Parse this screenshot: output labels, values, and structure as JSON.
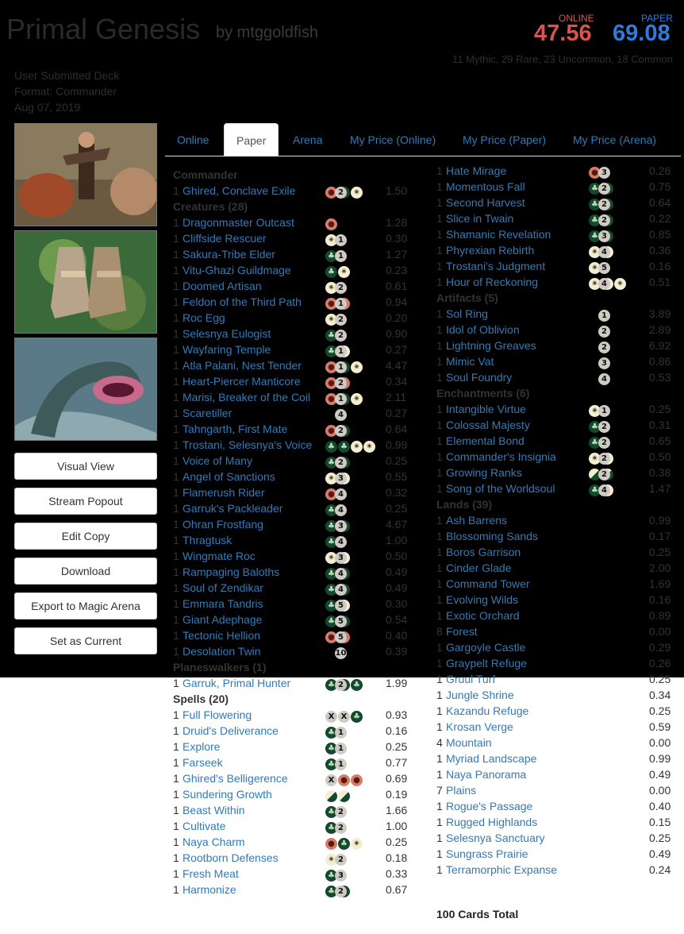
{
  "header": {
    "title": "Primal Genesis",
    "author": "by mtggoldfish",
    "online_label": "ONLINE",
    "online_price": "47.56",
    "paper_label": "PAPER",
    "paper_price": "69.08",
    "rarity_summary": "11 Mythic, 29 Rare, 23 Uncommon, 18 Common"
  },
  "meta": {
    "submitted": "User Submitted Deck",
    "format": "Format: Commander",
    "date": "Aug 07, 2019"
  },
  "colors": {
    "online": "#d9534f",
    "paper": "#2f7bdc",
    "link": "#337ab7"
  },
  "sidebar": {
    "images": [
      "ghired-art",
      "boots-art",
      "serpent-art"
    ],
    "buttons": [
      "Visual View",
      "Stream Popout",
      "Edit Copy",
      "Download",
      "Export to Magic Arena",
      "Set as Current"
    ]
  },
  "tabs": [
    "Online",
    "Paper",
    "Arena",
    "My Price (Online)",
    "My Price (Paper)",
    "My Price (Arena)"
  ],
  "active_tab": "Paper",
  "left_column": [
    {
      "type": "head",
      "text": "Commander"
    },
    {
      "type": "card",
      "qty": "1",
      "name": "Ghired, Conclave Exile",
      "mana": [
        "2",
        "R",
        "G",
        "W"
      ],
      "price": "1.50"
    },
    {
      "type": "head",
      "text": "Creatures (28)"
    },
    {
      "type": "card",
      "qty": "1",
      "name": "Dragonmaster Outcast",
      "mana": [
        "R"
      ],
      "price": "1.28"
    },
    {
      "type": "card",
      "qty": "1",
      "name": "Cliffside Rescuer",
      "mana": [
        "1",
        "W"
      ],
      "price": "0.30"
    },
    {
      "type": "card",
      "qty": "1",
      "name": "Sakura-Tribe Elder",
      "mana": [
        "1",
        "G"
      ],
      "price": "1.27"
    },
    {
      "type": "card",
      "qty": "1",
      "name": "Vitu-Ghazi Guildmage",
      "mana": [
        "G",
        "W"
      ],
      "price": "0.23"
    },
    {
      "type": "card",
      "qty": "1",
      "name": "Doomed Artisan",
      "mana": [
        "2",
        "W"
      ],
      "price": "0.61"
    },
    {
      "type": "card",
      "qty": "1",
      "name": "Feldon of the Third Path",
      "mana": [
        "1",
        "R",
        "R"
      ],
      "price": "0.94"
    },
    {
      "type": "card",
      "qty": "1",
      "name": "Roc Egg",
      "mana": [
        "2",
        "W"
      ],
      "price": "0.20"
    },
    {
      "type": "card",
      "qty": "1",
      "name": "Selesnya Eulogist",
      "mana": [
        "2",
        "G"
      ],
      "price": "0.90"
    },
    {
      "type": "card",
      "qty": "1",
      "name": "Wayfaring Temple",
      "mana": [
        "1",
        "G",
        "W"
      ],
      "price": "0.27"
    },
    {
      "type": "card",
      "qty": "1",
      "name": "Atla Palani, Nest Tender",
      "mana": [
        "1",
        "R",
        "G",
        "W"
      ],
      "price": "4.47"
    },
    {
      "type": "card",
      "qty": "1",
      "name": "Heart-Piercer Manticore",
      "mana": [
        "2",
        "R",
        "R"
      ],
      "price": "0.34"
    },
    {
      "type": "card",
      "qty": "1",
      "name": "Marisi, Breaker of the Coil",
      "mana": [
        "1",
        "R",
        "G",
        "W"
      ],
      "price": "2.11"
    },
    {
      "type": "card",
      "qty": "1",
      "name": "Scaretiller",
      "mana": [
        "4"
      ],
      "price": "0.27"
    },
    {
      "type": "card",
      "qty": "1",
      "name": "Tahngarth, First Mate",
      "mana": [
        "2",
        "R",
        "G"
      ],
      "price": "0.64"
    },
    {
      "type": "card",
      "qty": "1",
      "name": "Trostani, Selesnya's Voice",
      "mana": [
        "G",
        "G",
        "W",
        "W"
      ],
      "price": "0.99"
    },
    {
      "type": "card",
      "qty": "1",
      "name": "Voice of Many",
      "mana": [
        "2",
        "G",
        "G"
      ],
      "price": "0.25"
    },
    {
      "type": "card",
      "qty": "1",
      "name": "Angel of Sanctions",
      "mana": [
        "3",
        "W",
        "W"
      ],
      "price": "0.55"
    },
    {
      "type": "card",
      "qty": "1",
      "name": "Flamerush Rider",
      "mana": [
        "4",
        "R"
      ],
      "price": "0.32"
    },
    {
      "type": "card",
      "qty": "1",
      "name": "Garruk's Packleader",
      "mana": [
        "4",
        "G"
      ],
      "price": "0.25"
    },
    {
      "type": "card",
      "qty": "1",
      "name": "Ohran Frostfang",
      "mana": [
        "3",
        "G",
        "G"
      ],
      "price": "4.67"
    },
    {
      "type": "card",
      "qty": "1",
      "name": "Thragtusk",
      "mana": [
        "4",
        "G"
      ],
      "price": "1.00"
    },
    {
      "type": "card",
      "qty": "1",
      "name": "Wingmate Roc",
      "mana": [
        "3",
        "W",
        "W"
      ],
      "price": "0.50"
    },
    {
      "type": "card",
      "qty": "1",
      "name": "Rampaging Baloths",
      "mana": [
        "4",
        "G",
        "G"
      ],
      "price": "0.49"
    },
    {
      "type": "card",
      "qty": "1",
      "name": "Soul of Zendikar",
      "mana": [
        "4",
        "G",
        "G"
      ],
      "price": "0.49"
    },
    {
      "type": "card",
      "qty": "1",
      "name": "Emmara Tandris",
      "mana": [
        "5",
        "G",
        "W"
      ],
      "price": "0.30"
    },
    {
      "type": "card",
      "qty": "1",
      "name": "Giant Adephage",
      "mana": [
        "5",
        "G",
        "G"
      ],
      "price": "0.54"
    },
    {
      "type": "card",
      "qty": "1",
      "name": "Tectonic Hellion",
      "mana": [
        "5",
        "R",
        "R"
      ],
      "price": "0.40"
    },
    {
      "type": "card",
      "qty": "1",
      "name": "Desolation Twin",
      "mana": [
        "10"
      ],
      "price": "0.39"
    },
    {
      "type": "head",
      "text": "Planeswalkers (1)"
    },
    {
      "type": "card",
      "qty": "1",
      "name": "Garruk, Primal Hunter",
      "mana": [
        "2",
        "G",
        "G",
        "G"
      ],
      "price": "1.99"
    },
    {
      "type": "head",
      "text": "Spells (20)"
    },
    {
      "type": "card",
      "qty": "1",
      "name": "Full Flowering",
      "mana": [
        "X",
        "X",
        "G"
      ],
      "price": "0.93"
    },
    {
      "type": "card",
      "qty": "1",
      "name": "Druid's Deliverance",
      "mana": [
        "1",
        "G"
      ],
      "price": "0.16"
    },
    {
      "type": "card",
      "qty": "1",
      "name": "Explore",
      "mana": [
        "1",
        "G"
      ],
      "price": "0.25"
    },
    {
      "type": "card",
      "qty": "1",
      "name": "Farseek",
      "mana": [
        "1",
        "G"
      ],
      "price": "0.77"
    },
    {
      "type": "card",
      "qty": "1",
      "name": "Ghired's Belligerence",
      "mana": [
        "X",
        "R",
        "R"
      ],
      "price": "0.69"
    },
    {
      "type": "card",
      "qty": "1",
      "name": "Sundering Growth",
      "mana": [
        "GW",
        "GW"
      ],
      "price": "0.19"
    },
    {
      "type": "card",
      "qty": "1",
      "name": "Beast Within",
      "mana": [
        "2",
        "G"
      ],
      "price": "1.66"
    },
    {
      "type": "card",
      "qty": "1",
      "name": "Cultivate",
      "mana": [
        "2",
        "G"
      ],
      "price": "1.00"
    },
    {
      "type": "card",
      "qty": "1",
      "name": "Naya Charm",
      "mana": [
        "R",
        "G",
        "W"
      ],
      "price": "0.25"
    },
    {
      "type": "card",
      "qty": "1",
      "name": "Rootborn Defenses",
      "mana": [
        "2",
        "W"
      ],
      "price": "0.18"
    },
    {
      "type": "card",
      "qty": "1",
      "name": "Fresh Meat",
      "mana": [
        "3",
        "G"
      ],
      "price": "0.33"
    },
    {
      "type": "card",
      "qty": "1",
      "name": "Harmonize",
      "mana": [
        "2",
        "G",
        "G"
      ],
      "price": "0.67"
    }
  ],
  "right_column": [
    {
      "type": "card",
      "qty": "1",
      "name": "Hate Mirage",
      "mana": [
        "3",
        "R"
      ],
      "price": "0.26"
    },
    {
      "type": "card",
      "qty": "1",
      "name": "Momentous Fall",
      "mana": [
        "2",
        "G",
        "G"
      ],
      "price": "0.75"
    },
    {
      "type": "card",
      "qty": "1",
      "name": "Second Harvest",
      "mana": [
        "2",
        "G",
        "G"
      ],
      "price": "0.64"
    },
    {
      "type": "card",
      "qty": "1",
      "name": "Slice in Twain",
      "mana": [
        "2",
        "G",
        "G"
      ],
      "price": "0.22"
    },
    {
      "type": "card",
      "qty": "1",
      "name": "Shamanic Revelation",
      "mana": [
        "3",
        "G",
        "G"
      ],
      "price": "0.85"
    },
    {
      "type": "card",
      "qty": "1",
      "name": "Phyrexian Rebirth",
      "mana": [
        "4",
        "W",
        "W"
      ],
      "price": "0.36"
    },
    {
      "type": "card",
      "qty": "1",
      "name": "Trostani's Judgment",
      "mana": [
        "5",
        "W"
      ],
      "price": "0.16"
    },
    {
      "type": "card",
      "qty": "1",
      "name": "Hour of Reckoning",
      "mana": [
        "4",
        "W",
        "W",
        "W"
      ],
      "price": "0.51"
    },
    {
      "type": "head",
      "text": "Artifacts (5)"
    },
    {
      "type": "card",
      "qty": "1",
      "name": "Sol Ring",
      "mana": [
        "1"
      ],
      "price": "3.89"
    },
    {
      "type": "card",
      "qty": "1",
      "name": "Idol of Oblivion",
      "mana": [
        "2"
      ],
      "price": "2.89"
    },
    {
      "type": "card",
      "qty": "1",
      "name": "Lightning Greaves",
      "mana": [
        "2"
      ],
      "price": "6.92"
    },
    {
      "type": "card",
      "qty": "1",
      "name": "Mimic Vat",
      "mana": [
        "3"
      ],
      "price": "0.86"
    },
    {
      "type": "card",
      "qty": "1",
      "name": "Soul Foundry",
      "mana": [
        "4"
      ],
      "price": "0.53"
    },
    {
      "type": "head",
      "text": "Enchantments (6)"
    },
    {
      "type": "card",
      "qty": "1",
      "name": "Intangible Virtue",
      "mana": [
        "1",
        "W"
      ],
      "price": "0.25"
    },
    {
      "type": "card",
      "qty": "1",
      "name": "Colossal Majesty",
      "mana": [
        "2",
        "G"
      ],
      "price": "0.31"
    },
    {
      "type": "card",
      "qty": "1",
      "name": "Elemental Bond",
      "mana": [
        "2",
        "G"
      ],
      "price": "0.65"
    },
    {
      "type": "card",
      "qty": "1",
      "name": "Commander's Insignia",
      "mana": [
        "2",
        "W",
        "W"
      ],
      "price": "0.50"
    },
    {
      "type": "card",
      "qty": "1",
      "name": "Growing Ranks",
      "mana": [
        "2",
        "GW",
        "GW"
      ],
      "price": "0.38"
    },
    {
      "type": "card",
      "qty": "1",
      "name": "Song of the Worldsoul",
      "mana": [
        "4",
        "G",
        "W"
      ],
      "price": "1.47"
    },
    {
      "type": "head",
      "text": "Lands (39)"
    },
    {
      "type": "card",
      "qty": "1",
      "name": "Ash Barrens",
      "mana": [],
      "price": "0.99"
    },
    {
      "type": "card",
      "qty": "1",
      "name": "Blossoming Sands",
      "mana": [],
      "price": "0.17"
    },
    {
      "type": "card",
      "qty": "1",
      "name": "Boros Garrison",
      "mana": [],
      "price": "0.25"
    },
    {
      "type": "card",
      "qty": "1",
      "name": "Cinder Glade",
      "mana": [],
      "price": "2.00"
    },
    {
      "type": "card",
      "qty": "1",
      "name": "Command Tower",
      "mana": [],
      "price": "1.69"
    },
    {
      "type": "card",
      "qty": "1",
      "name": "Evolving Wilds",
      "mana": [],
      "price": "0.16"
    },
    {
      "type": "card",
      "qty": "1",
      "name": "Exotic Orchard",
      "mana": [],
      "price": "0.89"
    },
    {
      "type": "card",
      "qty": "8",
      "name": "Forest",
      "mana": [],
      "price": "0.00"
    },
    {
      "type": "card",
      "qty": "1",
      "name": "Gargoyle Castle",
      "mana": [],
      "price": "0.29"
    },
    {
      "type": "card",
      "qty": "1",
      "name": "Graypelt Refuge",
      "mana": [],
      "price": "0.26"
    },
    {
      "type": "card",
      "qty": "1",
      "name": "Gruul Turf",
      "mana": [],
      "price": "0.25"
    },
    {
      "type": "card",
      "qty": "1",
      "name": "Jungle Shrine",
      "mana": [],
      "price": "0.34"
    },
    {
      "type": "card",
      "qty": "1",
      "name": "Kazandu Refuge",
      "mana": [],
      "price": "0.25"
    },
    {
      "type": "card",
      "qty": "1",
      "name": "Krosan Verge",
      "mana": [],
      "price": "0.59"
    },
    {
      "type": "card",
      "qty": "4",
      "name": "Mountain",
      "mana": [],
      "price": "0.00"
    },
    {
      "type": "card",
      "qty": "1",
      "name": "Myriad Landscape",
      "mana": [],
      "price": "0.99"
    },
    {
      "type": "card",
      "qty": "1",
      "name": "Naya Panorama",
      "mana": [],
      "price": "0.49"
    },
    {
      "type": "card",
      "qty": "7",
      "name": "Plains",
      "mana": [],
      "price": "0.00"
    },
    {
      "type": "card",
      "qty": "1",
      "name": "Rogue's Passage",
      "mana": [],
      "price": "0.40"
    },
    {
      "type": "card",
      "qty": "1",
      "name": "Rugged Highlands",
      "mana": [],
      "price": "0.15"
    },
    {
      "type": "card",
      "qty": "1",
      "name": "Selesnya Sanctuary",
      "mana": [],
      "price": "0.25"
    },
    {
      "type": "card",
      "qty": "1",
      "name": "Sungrass Prairie",
      "mana": [],
      "price": "0.49"
    },
    {
      "type": "card",
      "qty": "1",
      "name": "Terramorphic Expanse",
      "mana": [],
      "price": "0.24"
    }
  ],
  "total": "100 Cards Total"
}
